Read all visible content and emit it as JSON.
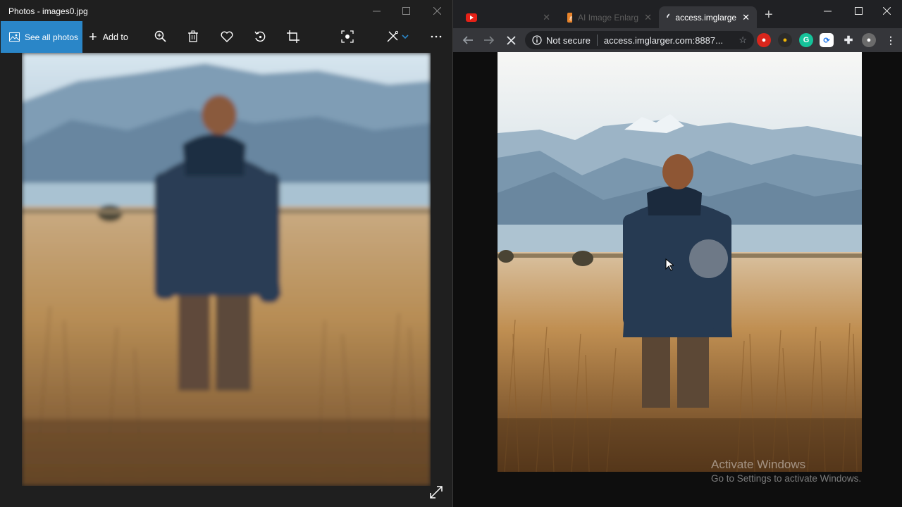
{
  "photos_app": {
    "window_title": "Photos - images0.jpg",
    "toolbar": {
      "see_all_label": "See all photos",
      "add_to_label": "Add to",
      "icons": [
        "zoom-in-icon",
        "delete-icon",
        "favorite-icon",
        "rotate-icon",
        "crop-icon",
        "enhance-icon",
        "edit-icon",
        "more-icon"
      ]
    },
    "accent_color": "#2a86c8"
  },
  "browser": {
    "tabs": [
      {
        "label": "",
        "icon": "youtube-icon"
      },
      {
        "label": "AI Image Enlarg",
        "icon": "favicon-icon"
      },
      {
        "label": "access.imglarge",
        "icon": "loading-icon",
        "active": true
      }
    ],
    "address": {
      "security_label": "Not secure",
      "url": "access.imglarger.com:8887..."
    },
    "watermark": {
      "title": "Activate Windows",
      "subtitle": "Go to Settings to activate Windows."
    }
  }
}
